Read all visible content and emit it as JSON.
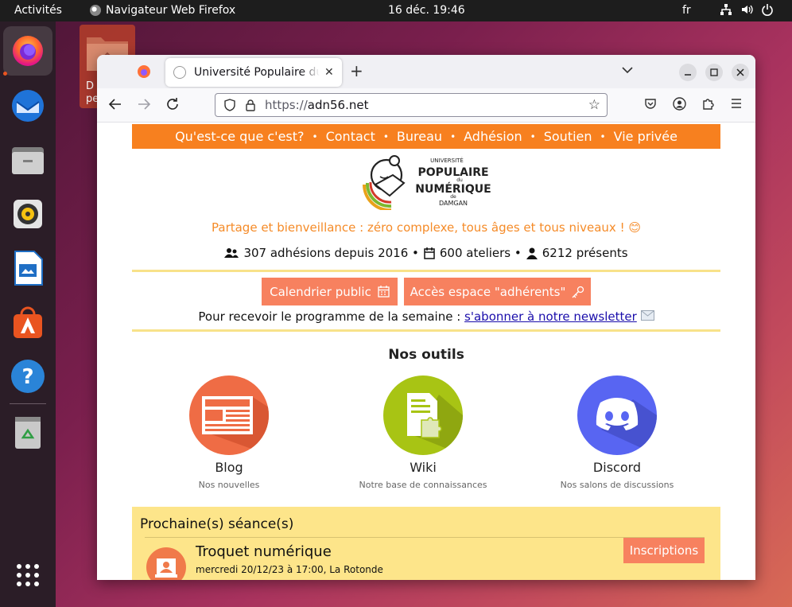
{
  "topbar": {
    "activities": "Activités",
    "app_name": "Navigateur Web Firefox",
    "clock": "16 déc.  19:46",
    "lang": "fr"
  },
  "desktop": {
    "folder_label": "D\nper"
  },
  "browser": {
    "tab_title": "Université Populaire du N",
    "url_proto": "https://",
    "url_host": "adn56.net"
  },
  "site": {
    "nav": [
      "Qu'est-ce que c'est?",
      "Contact",
      "Bureau",
      "Adhésion",
      "Soutien",
      "Vie privée"
    ],
    "logo": {
      "line1": "UNIVERSITÉ",
      "line2": "POPULAIRE",
      "line3": "du",
      "line4": "NUMÉRIQUE",
      "line5": "de",
      "line6": "DAMGAN"
    },
    "tagline": "Partage et bienveillance : zéro complexe, tous âges et tous niveaux ! 😊",
    "stats": {
      "members": "307 adhésions depuis 2016 •",
      "workshops": "600 ateliers •",
      "attendees": "6212 présents"
    },
    "buttons": {
      "calendar": "Calendrier public",
      "members_area": "Accès espace \"adhérents\""
    },
    "newsletter": {
      "text": "Pour recevoir le programme de la semaine :",
      "link": "s'abonner à notre newsletter"
    },
    "tools_title": "Nos outils",
    "tools": [
      {
        "name": "Blog",
        "desc": "Nos nouvelles",
        "color": "#ef6c45"
      },
      {
        "name": "Wiki",
        "desc": "Notre base de connaissances",
        "color": "#a8c414"
      },
      {
        "name": "Discord",
        "desc": "Nos salons de discussions",
        "color": "#5865f2"
      }
    ],
    "next": {
      "title": "Prochaine(s) séance(s)",
      "event_title": "Troquet numérique",
      "event_date": "mercredi 20/12/23 à 17:00, La Rotonde",
      "register": "Inscriptions"
    }
  }
}
